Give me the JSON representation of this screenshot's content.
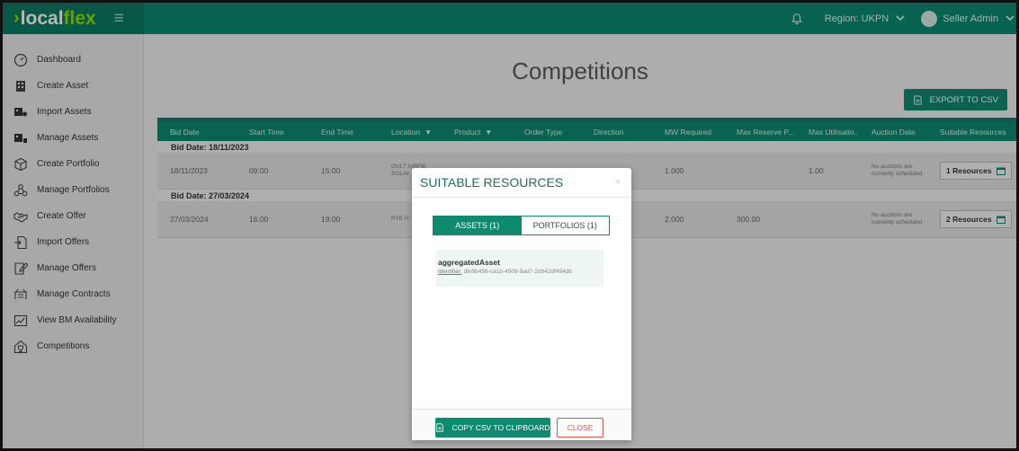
{
  "header": {
    "logo_chevron": "›",
    "logo_part1": "local",
    "logo_part2": "flex",
    "menu_glyph": "≡",
    "region_label": "Region: UKPN",
    "user_label": "Seller Admin",
    "brand_color": "#0e8a6f",
    "accent_color": "#8ee000"
  },
  "sidebar": {
    "items": [
      {
        "label": "Dashboard",
        "icon": "dashboard-gauge-icon"
      },
      {
        "label": "Create Asset",
        "icon": "building-icon"
      },
      {
        "label": "Import Assets",
        "icon": "import-assets-icon"
      },
      {
        "label": "Manage Assets",
        "icon": "manage-assets-icon"
      },
      {
        "label": "Create Portfolio",
        "icon": "cube-icon"
      },
      {
        "label": "Manage Portfolios",
        "icon": "network-icon"
      },
      {
        "label": "Create Offer",
        "icon": "handshake-icon"
      },
      {
        "label": "Import Offers",
        "icon": "file-import-icon"
      },
      {
        "label": "Manage Offers",
        "icon": "edit-document-icon"
      },
      {
        "label": "Manage Contracts",
        "icon": "contract-icon"
      },
      {
        "label": "View BM Availability",
        "icon": "chart-icon"
      },
      {
        "label": "Competitions",
        "icon": "trophy-home-icon"
      }
    ]
  },
  "main": {
    "title": "Competitions",
    "export_label": "EXPORT TO CSV",
    "columns": [
      "Bid Date",
      "Start Time",
      "End Time",
      "Location",
      "Product",
      "Order Type",
      "Direction",
      "MW Required",
      "Max Reserve P...",
      "Max Utilisatio...",
      "Auction Date",
      "Suitable Resources"
    ],
    "filter_glyph": "▼",
    "groups": [
      {
        "label": "Bid Date: 18/11/2023",
        "row": {
          "bid_date": "18/11/2023",
          "start": "09:00",
          "end": "15:00",
          "location": "OULT AIRFIE SOLAI",
          "mw": "1.000",
          "max_reserve": "",
          "max_util": "1.00",
          "auction": "No auctions are currently scheduled",
          "resources": "1 Resources"
        }
      },
      {
        "label": "Bid Date: 27/03/2024",
        "row": {
          "bid_date": "27/03/2024",
          "start": "16:00",
          "end": "19:00",
          "location": "RYE H 132/3",
          "mw": "2.000",
          "max_reserve": "300.00",
          "max_util": "",
          "auction": "No auctions are currently scheduled",
          "resources": "2 Resources"
        }
      }
    ]
  },
  "modal": {
    "title": "SUITABLE RESOURCES",
    "close_x": "×",
    "tab_assets": "ASSETS (1)",
    "tab_portfolios": "PORTFOLIOS (1)",
    "asset_name": "aggregatedAsset",
    "identifier_label": "Identifier:",
    "identifier_value": "dfe9b456-ca1b-4909-9ad7-2d942df494db",
    "copy_label": "COPY CSV TO CLIPBOARD",
    "close_label": "CLOSE"
  }
}
